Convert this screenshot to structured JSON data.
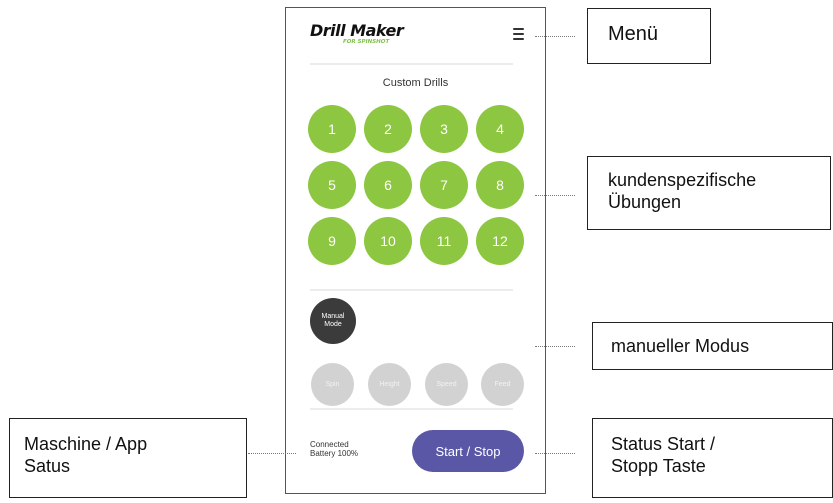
{
  "app": {
    "brand_name": "Drill Maker",
    "brand_sub": "FOR SPINSHOT",
    "section_title": "Custom Drills",
    "drills": [
      "1",
      "2",
      "3",
      "4",
      "5",
      "6",
      "7",
      "8",
      "9",
      "10",
      "11",
      "12"
    ],
    "manual_mode": {
      "line1": "Manual",
      "line2": "Mode"
    },
    "params": [
      "Spin",
      "Height",
      "Speed",
      "Feed"
    ],
    "status": {
      "connected": "Connected",
      "battery": "Battery 100%"
    },
    "start_stop": "Start / Stop",
    "icons": {
      "menu": "hamburger-menu-icon"
    },
    "colors": {
      "drill_green": "#8dc641",
      "button_purple": "#5a57a6",
      "manual_dark": "#3b3b3b",
      "param_grey": "#d2d2d2",
      "brand_sub": "#7fc24a"
    }
  },
  "annotations": {
    "menu": "Menü",
    "custom_exercises_line1": "kundenspezifische",
    "custom_exercises_line2": "Übungen",
    "manual_mode": "manueller Modus",
    "machine_status_line1": "Maschine / App",
    "machine_status_line2": "Satus",
    "start_stop_line1": "Status Start /",
    "start_stop_line2": "Stopp Taste"
  }
}
